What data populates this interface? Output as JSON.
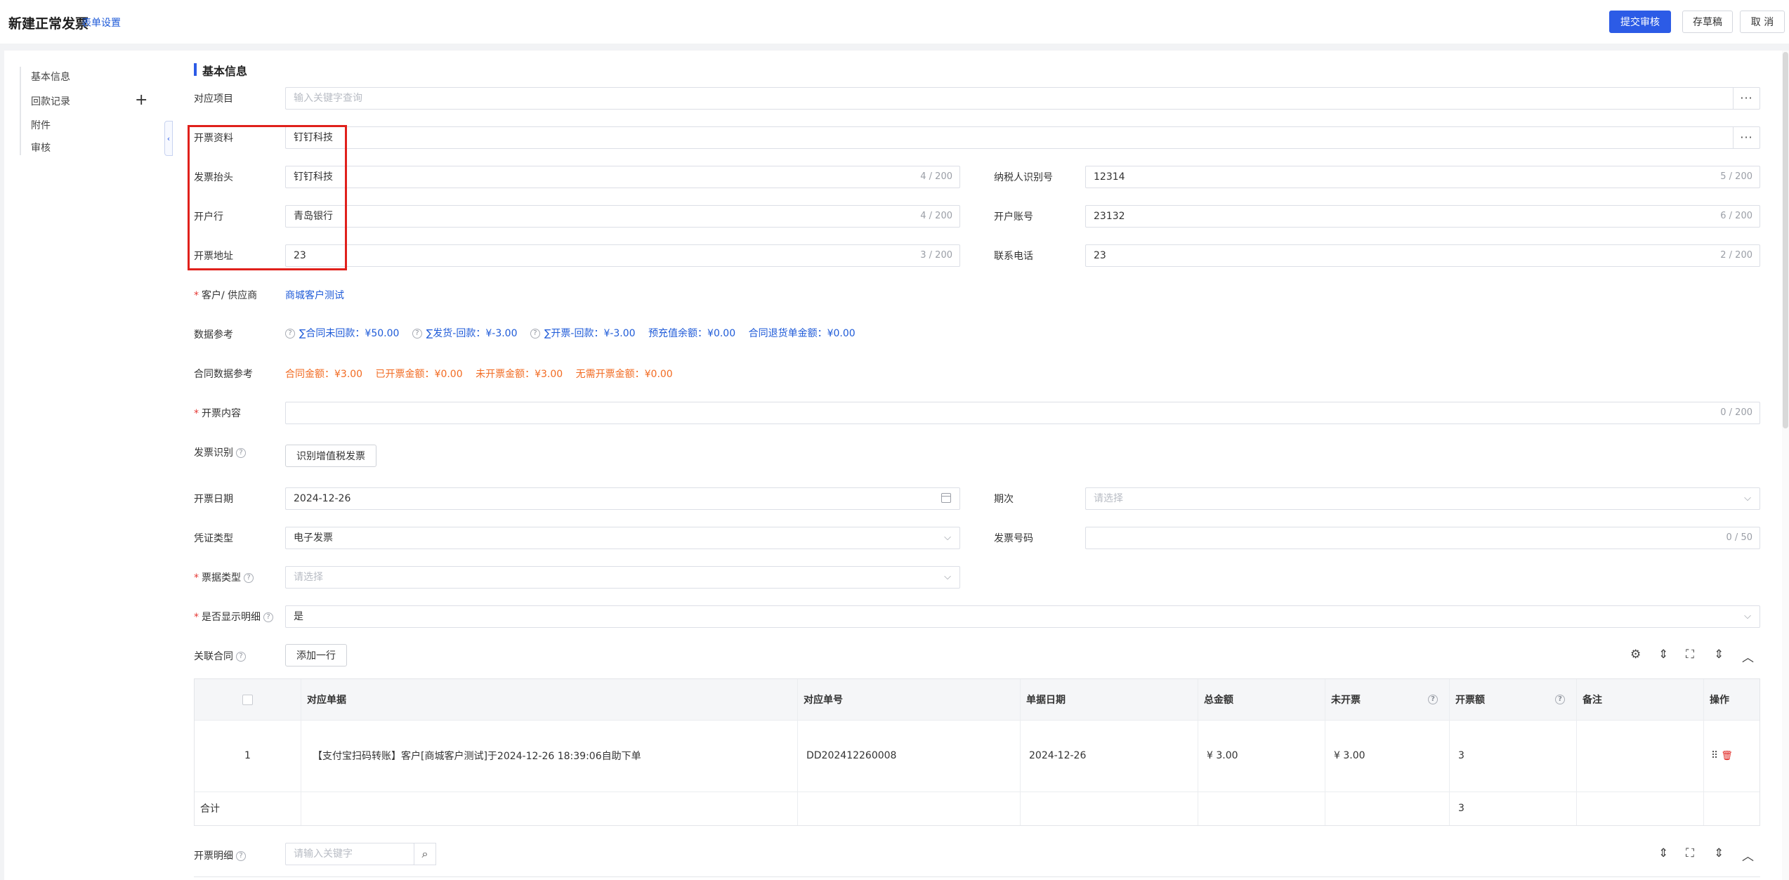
{
  "header": {
    "title": "新建正常发票",
    "form_setting": "表单设置",
    "submit_label": "提交审核",
    "draft_label": "存草稿",
    "cancel_label": "取 消"
  },
  "sidebar": {
    "items": [
      {
        "label": "基本信息"
      },
      {
        "label": "回款记录"
      },
      {
        "label": "附件"
      },
      {
        "label": "审核"
      }
    ],
    "collapse_glyph": "‹"
  },
  "section": {
    "title": "基本信息"
  },
  "form": {
    "project": {
      "label": "对应项目",
      "placeholder": "输入关键字查询",
      "more": "···"
    },
    "invoice_data": {
      "label": "开票资料",
      "value": "钉钉科技",
      "more": "···"
    },
    "invoice_header": {
      "label": "发票抬头",
      "value": "钉钉科技",
      "counter": "4 / 200"
    },
    "taxpayer_id": {
      "label": "纳税人识别号",
      "value": "12314",
      "counter": "5 / 200"
    },
    "bank": {
      "label": "开户行",
      "value": "青岛银行",
      "counter": "4 / 200"
    },
    "account": {
      "label": "开户账号",
      "value": "23132",
      "counter": "6 / 200"
    },
    "address": {
      "label": "开票地址",
      "value": "23",
      "counter": "3 / 200"
    },
    "phone": {
      "label": "联系电话",
      "value": "23",
      "counter": "2 / 200"
    },
    "customer": {
      "label": "客户/ 供应商",
      "value": "商城客户测试"
    },
    "data_ref": {
      "label": "数据参考",
      "items": [
        "∑合同未回款：¥50.00",
        "∑发货-回款：¥-3.00",
        "∑开票-回款：¥-3.00",
        "预充值余额：¥0.00",
        "合同退货单金额：¥0.00"
      ]
    },
    "contract_ref": {
      "label": "合同数据参考",
      "items": [
        "合同金额：¥3.00",
        "已开票金额：¥0.00",
        "未开票金额：¥3.00",
        "无需开票金额：¥0.00"
      ]
    },
    "content": {
      "label": "开票内容",
      "counter": "0 / 200"
    },
    "recognize": {
      "label": "发票识别",
      "button": "识别增值税发票"
    },
    "invoice_date": {
      "label": "开票日期",
      "value": "2024-12-26"
    },
    "period": {
      "label": "期次",
      "placeholder": "请选择"
    },
    "voucher_type": {
      "label": "凭证类型",
      "value": "电子发票"
    },
    "invoice_no": {
      "label": "发票号码",
      "counter": "0 / 50"
    },
    "ticket_type": {
      "label": "票据类型",
      "placeholder": "请选择"
    },
    "show_detail": {
      "label": "是否显示明细",
      "value": "是"
    },
    "related_contract": {
      "label": "关联合同",
      "add_row": "添加一行"
    },
    "invoice_detail": {
      "label": "开票明细",
      "placeholder": "请输入关键字"
    }
  },
  "table": {
    "columns": [
      "对应单据",
      "对应单号",
      "单据日期",
      "总金额",
      "未开票",
      "开票额",
      "备注",
      "操作"
    ],
    "rows": [
      {
        "index": "1",
        "doc": "【支付宝扫码转账】客户[商城客户测试]于2024-12-26 18:39:06自助下单",
        "doc_no": "DD202412260008",
        "date": "2024-12-26",
        "total": "¥ 3.00",
        "unbilled": "¥ 3.00",
        "amount": "3",
        "remark": ""
      }
    ],
    "total_row": {
      "label": "合计",
      "amount": "3"
    }
  },
  "icons": {
    "chevron": "⌵",
    "drag": "⠿",
    "delete": "🗑",
    "settings": "⚙",
    "density": "⇕",
    "fullscreen": "⛶",
    "collapse": "︿",
    "search": "⌕"
  },
  "colors": {
    "primary": "#2c5be6",
    "link": "#1f5bd8",
    "orange": "#f26b22",
    "danger": "#e0201b"
  }
}
